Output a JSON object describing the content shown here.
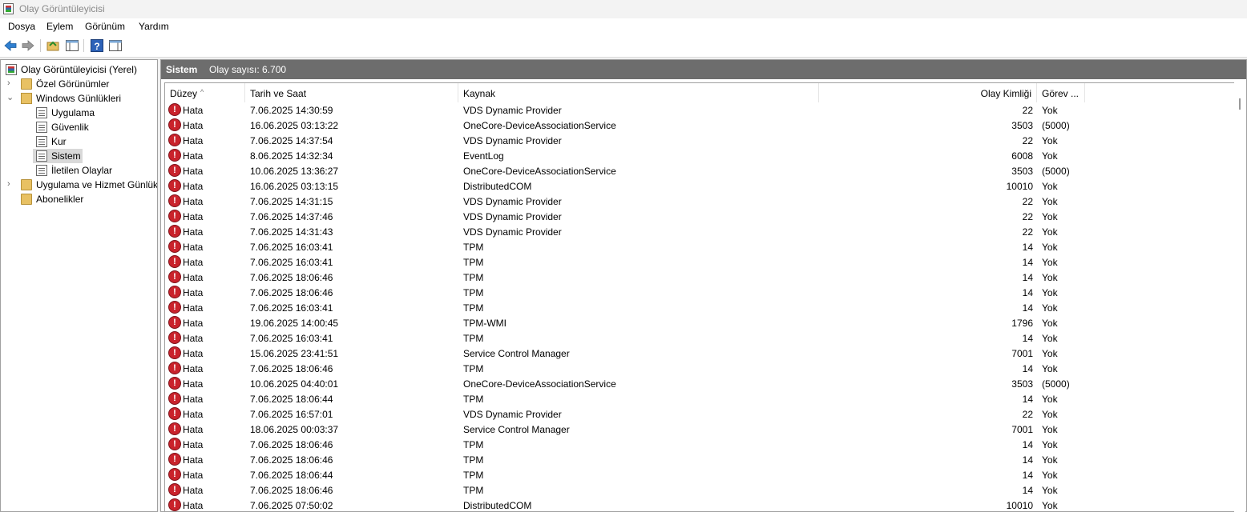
{
  "window": {
    "title": "Olay Görüntüleyicisi"
  },
  "menu": [
    "Dosya",
    "Eylem",
    "Görünüm",
    "Yardım"
  ],
  "toolbar": {
    "icons": [
      "back-arrow-icon",
      "forward-arrow-icon",
      "open-folder-icon",
      "console-tree-icon",
      "help-icon",
      "action-pane-icon"
    ]
  },
  "tree": {
    "root": "Olay Görüntüleyicisi (Yerel)",
    "custom_views": "Özel Görünümler",
    "windows_logs": "Windows Günlükleri",
    "windows_logs_items": [
      "Uygulama",
      "Güvenlik",
      "Kur",
      "Sistem",
      "İletilen Olaylar"
    ],
    "app_service_logs": "Uygulama ve Hizmet Günlük",
    "subscriptions": "Abonelikler",
    "selected": "Sistem"
  },
  "panel": {
    "title": "Sistem",
    "count_text": "Olay sayısı: 6.700"
  },
  "columns": [
    "Düzey",
    "Tarih ve Saat",
    "Kaynak",
    "Olay Kimliği",
    "Görev ..."
  ],
  "events": [
    {
      "level": "Hata",
      "datetime": "7.06.2025 14:30:59",
      "source": "VDS Dynamic Provider",
      "id": "22",
      "task": "Yok"
    },
    {
      "level": "Hata",
      "datetime": "16.06.2025 03:13:22",
      "source": "OneCore-DeviceAssociationService",
      "id": "3503",
      "task": "(5000)"
    },
    {
      "level": "Hata",
      "datetime": "7.06.2025 14:37:54",
      "source": "VDS Dynamic Provider",
      "id": "22",
      "task": "Yok"
    },
    {
      "level": "Hata",
      "datetime": "8.06.2025 14:32:34",
      "source": "EventLog",
      "id": "6008",
      "task": "Yok"
    },
    {
      "level": "Hata",
      "datetime": "10.06.2025 13:36:27",
      "source": "OneCore-DeviceAssociationService",
      "id": "3503",
      "task": "(5000)"
    },
    {
      "level": "Hata",
      "datetime": "16.06.2025 03:13:15",
      "source": "DistributedCOM",
      "id": "10010",
      "task": "Yok"
    },
    {
      "level": "Hata",
      "datetime": "7.06.2025 14:31:15",
      "source": "VDS Dynamic Provider",
      "id": "22",
      "task": "Yok"
    },
    {
      "level": "Hata",
      "datetime": "7.06.2025 14:37:46",
      "source": "VDS Dynamic Provider",
      "id": "22",
      "task": "Yok"
    },
    {
      "level": "Hata",
      "datetime": "7.06.2025 14:31:43",
      "source": "VDS Dynamic Provider",
      "id": "22",
      "task": "Yok"
    },
    {
      "level": "Hata",
      "datetime": "7.06.2025 16:03:41",
      "source": "TPM",
      "id": "14",
      "task": "Yok"
    },
    {
      "level": "Hata",
      "datetime": "7.06.2025 16:03:41",
      "source": "TPM",
      "id": "14",
      "task": "Yok"
    },
    {
      "level": "Hata",
      "datetime": "7.06.2025 18:06:46",
      "source": "TPM",
      "id": "14",
      "task": "Yok"
    },
    {
      "level": "Hata",
      "datetime": "7.06.2025 18:06:46",
      "source": "TPM",
      "id": "14",
      "task": "Yok"
    },
    {
      "level": "Hata",
      "datetime": "7.06.2025 16:03:41",
      "source": "TPM",
      "id": "14",
      "task": "Yok"
    },
    {
      "level": "Hata",
      "datetime": "19.06.2025 14:00:45",
      "source": "TPM-WMI",
      "id": "1796",
      "task": "Yok"
    },
    {
      "level": "Hata",
      "datetime": "7.06.2025 16:03:41",
      "source": "TPM",
      "id": "14",
      "task": "Yok"
    },
    {
      "level": "Hata",
      "datetime": "15.06.2025 23:41:51",
      "source": "Service Control Manager",
      "id": "7001",
      "task": "Yok"
    },
    {
      "level": "Hata",
      "datetime": "7.06.2025 18:06:46",
      "source": "TPM",
      "id": "14",
      "task": "Yok"
    },
    {
      "level": "Hata",
      "datetime": "10.06.2025 04:40:01",
      "source": "OneCore-DeviceAssociationService",
      "id": "3503",
      "task": "(5000)"
    },
    {
      "level": "Hata",
      "datetime": "7.06.2025 18:06:44",
      "source": "TPM",
      "id": "14",
      "task": "Yok"
    },
    {
      "level": "Hata",
      "datetime": "7.06.2025 16:57:01",
      "source": "VDS Dynamic Provider",
      "id": "22",
      "task": "Yok"
    },
    {
      "level": "Hata",
      "datetime": "18.06.2025 00:03:37",
      "source": "Service Control Manager",
      "id": "7001",
      "task": "Yok"
    },
    {
      "level": "Hata",
      "datetime": "7.06.2025 18:06:46",
      "source": "TPM",
      "id": "14",
      "task": "Yok"
    },
    {
      "level": "Hata",
      "datetime": "7.06.2025 18:06:46",
      "source": "TPM",
      "id": "14",
      "task": "Yok"
    },
    {
      "level": "Hata",
      "datetime": "7.06.2025 18:06:44",
      "source": "TPM",
      "id": "14",
      "task": "Yok"
    },
    {
      "level": "Hata",
      "datetime": "7.06.2025 18:06:46",
      "source": "TPM",
      "id": "14",
      "task": "Yok"
    },
    {
      "level": "Hata",
      "datetime": "7.06.2025 07:50:02",
      "source": "DistributedCOM",
      "id": "10010",
      "task": "Yok"
    }
  ],
  "colors": {
    "panel_header": "#6d6d6d",
    "error_icon": "#c9222b",
    "selection": "#d9d9d9"
  }
}
